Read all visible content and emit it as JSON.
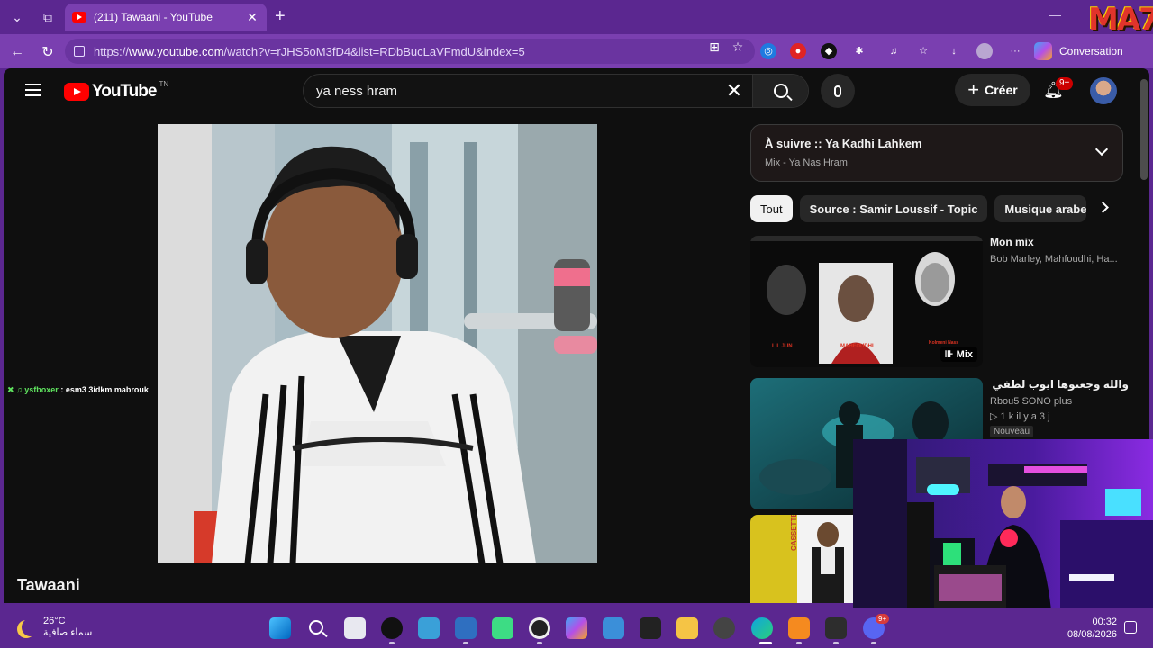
{
  "browser": {
    "tab_title": "(211) Tawaani - YouTube",
    "url_prefix": "https://",
    "url_domain": "www.youtube.com",
    "url_path": "/watch?v=rJHS5oM3fD4&list=RDbBucLaVFmdU&index=5",
    "conversation_label": "Conversation",
    "overlay_logo_text": "MA7"
  },
  "youtube": {
    "logo_text": "YouTube",
    "logo_tm": "TN",
    "search_query": "ya ness hram",
    "create_label": "Créer",
    "notifications_badge": "9+",
    "video_title": "Tawaani",
    "up_next": {
      "title": "À suivre :: Ya Kadhi Lahkem",
      "subtitle": "Mix - Ya Nas Hram"
    },
    "chips": [
      "Tout",
      "Source : Samir Loussif - Topic",
      "Musique arabe"
    ],
    "recommendations": [
      {
        "title": "Mon mix",
        "channel": "Bob Marley, Mahfoudhi, Ha...",
        "tag": "Mix",
        "thumb_labels": [
          "LIL JUN",
          "MAHFOUDHI",
          "Kolmeni Nass"
        ]
      },
      {
        "title": "والله وجعتوها  ايوب لطفي جرمانة",
        "channel": "Rbou5 SONO plus",
        "stats": "1 k  il y a 3 j",
        "badge": "Nouveau"
      },
      {
        "title": "",
        "channel": "",
        "thumb_label": "CASSETTE 2000"
      }
    ]
  },
  "chat_overlay": {
    "user": "ysfboxer",
    "message": " : esm3 3idkm mabrouk"
  },
  "taskbar": {
    "temperature": "26°C",
    "condition": "سماء صافية",
    "time": "00:32",
    "date": "08/08/2026",
    "discord_badge": "9+"
  }
}
